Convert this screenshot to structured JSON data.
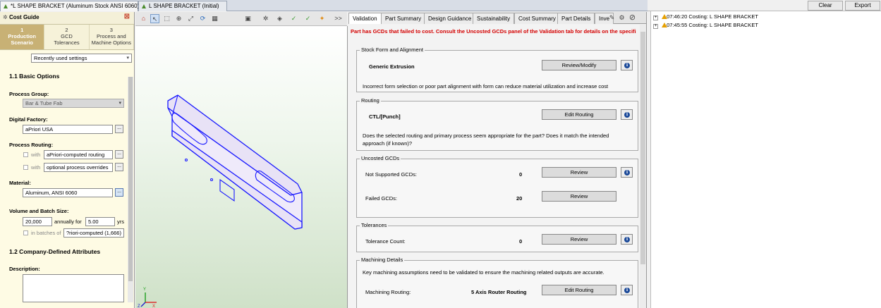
{
  "doc_tabs": [
    {
      "label": "*L SHAPE BRACKET (Aluminum Stock ANSI 6060)",
      "active": true,
      "close": "⊠"
    },
    {
      "label": "L SHAPE BRACKET (Initial)",
      "active": false
    }
  ],
  "cost_guide": {
    "title": "Cost Guide",
    "close": "⊠",
    "steps": [
      {
        "num": "1",
        "label1": "Production",
        "label2": "Scenario",
        "active": true
      },
      {
        "num": "2",
        "label1": "GCD",
        "label2": "Tolerances",
        "active": false
      },
      {
        "num": "3",
        "label1": "Process and",
        "label2": "Machine Options",
        "active": false
      }
    ],
    "settings_select": "Recently used settings",
    "basic_options_title": "1.1 Basic Options",
    "process_group_label": "Process Group:",
    "process_group_value": "Bar & Tube Fab",
    "digital_factory_label": "Digital Factory:",
    "digital_factory_value": "aPriori USA",
    "process_routing_label": "Process Routing:",
    "routing_with_1": "with",
    "routing_value_1": "aPriori-computed routing",
    "routing_with_2": "with",
    "routing_value_2": "optional process overrides",
    "material_label": "Material:",
    "material_value": "Aluminum, ANSI 6060",
    "volume_label": "Volume and Batch Size:",
    "volume_value": "20,000",
    "annually_for": "annually for",
    "years_value": "5.00",
    "years_unit": "yrs",
    "in_batches_of": "in batches of",
    "batch_value": "?riori-computed (1,666)",
    "company_title": "1.2 Company-Defined Attributes",
    "description_label": "Description:",
    "dots": "..."
  },
  "viewport_toolbar": {
    "more": ">>"
  },
  "triad": {
    "x": "X",
    "y": "Y",
    "z": "Z"
  },
  "validation": {
    "tabs": [
      {
        "label": "Validation",
        "active": true
      },
      {
        "label": "Part Summary",
        "active": false
      },
      {
        "label": "Design Guidance",
        "active": false
      },
      {
        "label": "Sustainability",
        "active": false
      },
      {
        "label": "Cost Summary",
        "active": false
      },
      {
        "label": "Part Details",
        "active": false
      },
      {
        "label": "Inve",
        "active": false
      }
    ],
    "warning": "Part has GCDs that failed to cost. Consult the Uncosted GCDs panel of the Validation tab for details on the specifi",
    "stock": {
      "title": "Stock Form and Alignment",
      "value": "Generic Extrusion",
      "button": "Review/Modify",
      "note": "Incorrect form selection or poor part alignment with form can reduce material utilization and increase cost"
    },
    "routing": {
      "title": "Routing",
      "value": "CTL/[Punch]",
      "button": "Edit Routing",
      "note1": "Does the selected routing and primary process seem appropriate for the part? Does it match the intended",
      "note2": "approach (if known)?"
    },
    "uncosted": {
      "title": "Uncosted GCDs",
      "not_supported_label": "Not Supported GCDs:",
      "not_supported_value": "0",
      "failed_label": "Failed GCDs:",
      "failed_value": "20",
      "button": "Review"
    },
    "tolerances": {
      "title": "Tolerances",
      "count_label": "Tolerance Count:",
      "count_value": "0",
      "button": "Review"
    },
    "machining": {
      "title": "Machining Details",
      "note": "Key machining assumptions need to be validated to ensure the machining related outputs are accurate.",
      "routing_label": "Machining Routing:",
      "routing_value": "5 Axis Router Routing",
      "button": "Edit Routing"
    },
    "info_glyph": "i"
  },
  "history": {
    "clear": "Clear",
    "export": "Export",
    "entries": [
      {
        "expand": "+",
        "time": "07:46:20",
        "text": "Costing: L SHAPE BRACKET"
      },
      {
        "expand": "+",
        "time": "07:45:55",
        "text": "Costing: L SHAPE BRACKET"
      }
    ]
  },
  "colors": {
    "accent_step": "#c8b175",
    "warning_red": "#d40000",
    "info_blue": "#1c4a99",
    "model_blue": "#1a1aff"
  }
}
